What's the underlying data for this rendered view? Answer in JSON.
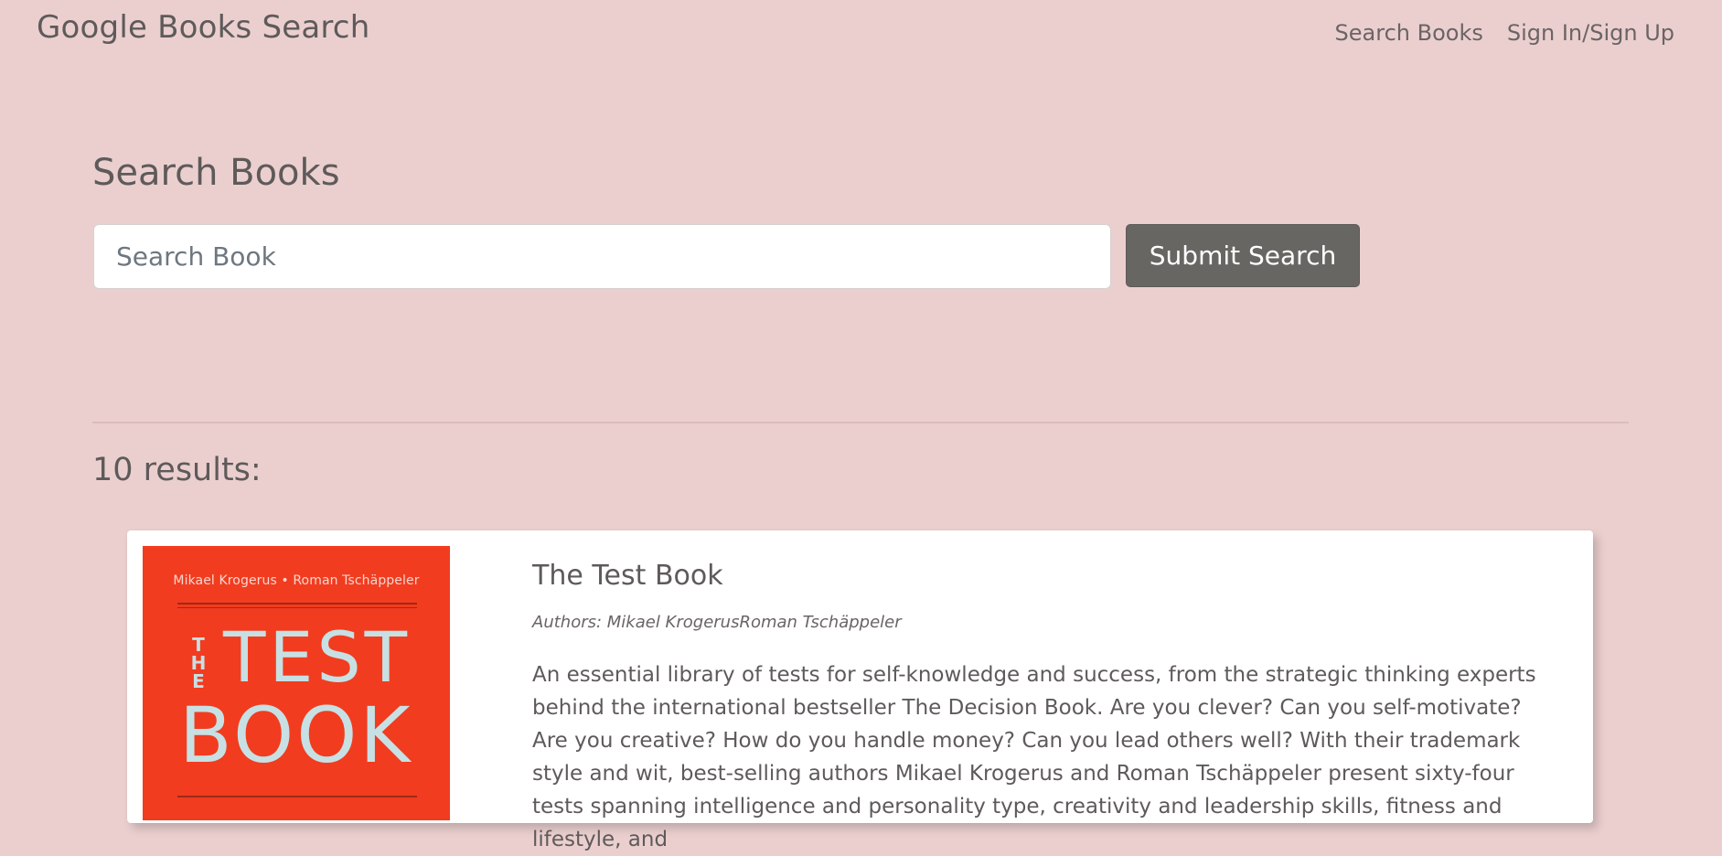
{
  "header": {
    "brand": "Google Books Search",
    "nav": [
      {
        "label": "Search Books"
      },
      {
        "label": "Sign In/Sign Up"
      }
    ]
  },
  "main": {
    "title": "Search Books",
    "search": {
      "value": "",
      "placeholder": "Search Book"
    },
    "submit_label": "Submit Search",
    "results_count": "10 results:"
  },
  "results": [
    {
      "title": "The Test Book",
      "authors": "Authors: Mikael KrogerusRoman Tschäppeler",
      "description": "An essential library of tests for self-knowledge and success, from the strategic thinking experts behind the international bestseller The Decision Book. Are you clever? Can you self-motivate? Are you creative? How do you handle money? Can you lead others well? With their trademark style and wit, best-selling authors Mikael Krogerus and Roman Tschäppeler present sixty-four tests spanning intelligence and personality type, creativity and leadership skills, fitness and lifestyle, and",
      "cover": {
        "authors": "Mikael Krogerus • Roman Tschäppeler",
        "word_the": "THE",
        "word_test": "TEST",
        "word_book": "BOOK",
        "background_color": "#f23c1f",
        "text_color": "#c7e0e4"
      }
    }
  ],
  "colors": {
    "page_background": "#ebcfcf",
    "button_background": "#686663",
    "text": "#5f5a5a"
  }
}
